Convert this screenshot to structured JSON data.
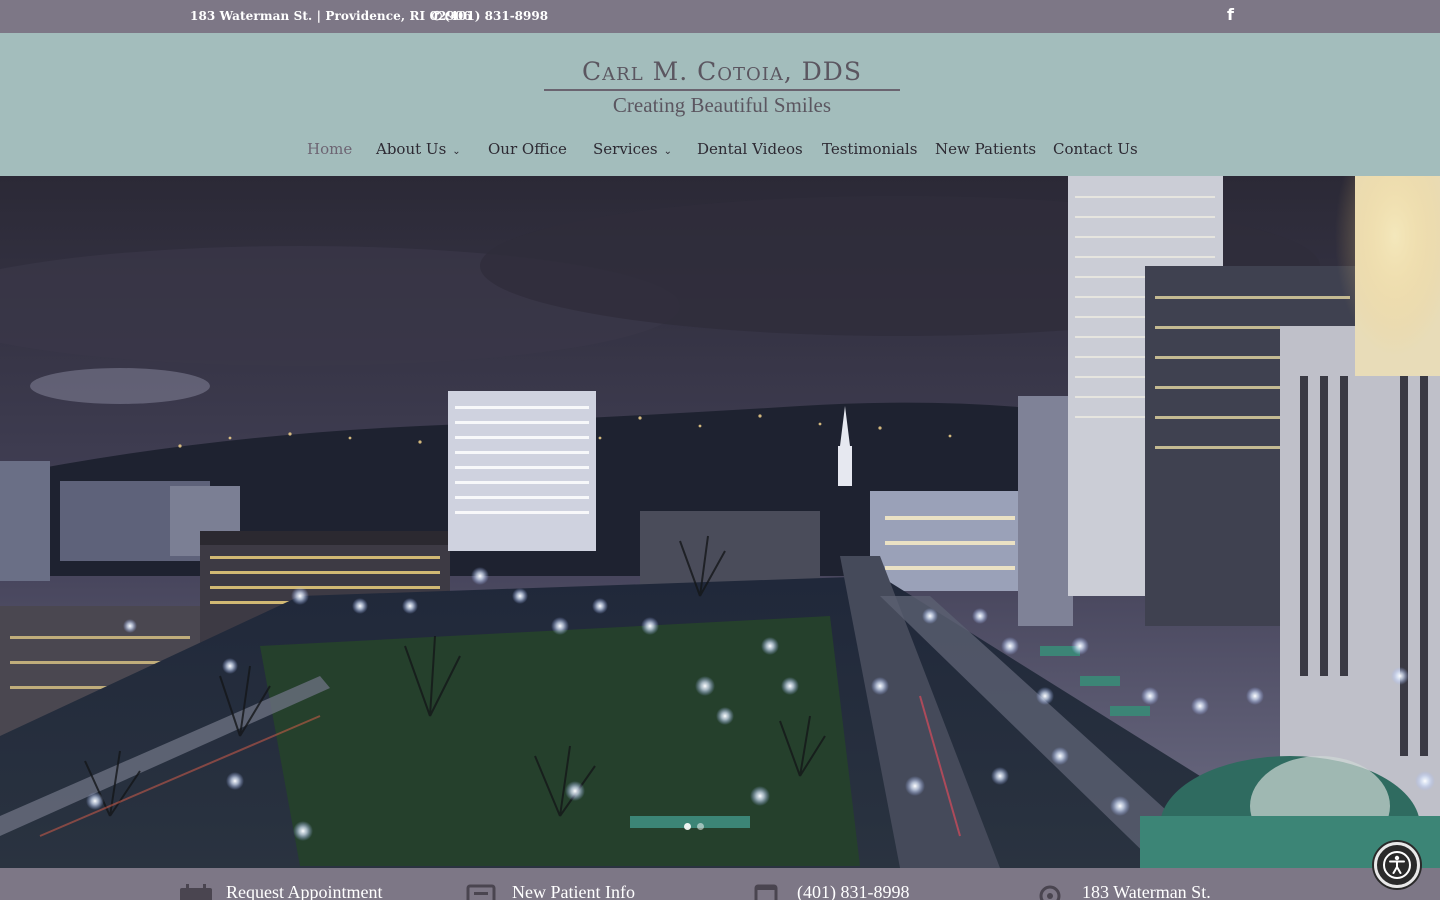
{
  "topbar": {
    "address": "183 Waterman St. | Providence, RI 02906",
    "phone": "(401) 831-8998",
    "facebook_glyph": "f"
  },
  "logo": {
    "name": "Carl M. Cotoia, DDS",
    "tagline": "Creating Beautiful Smiles"
  },
  "nav": {
    "items": [
      {
        "label": "Home",
        "active": true
      },
      {
        "label": "About Us",
        "dropdown": true
      },
      {
        "label": "Our Office"
      },
      {
        "label": "Services",
        "dropdown": true
      },
      {
        "label": "Dental Videos"
      },
      {
        "label": "Testimonials"
      },
      {
        "label": "New Patients"
      },
      {
        "label": "Contact Us"
      }
    ]
  },
  "bottombar": {
    "items": [
      {
        "icon": "calendar-icon",
        "label": "Request Appointment"
      },
      {
        "icon": "message-icon",
        "label": "New Patient Info"
      },
      {
        "icon": "calendar-icon",
        "label": "(401) 831-8998"
      },
      {
        "icon": "map-pin-icon",
        "label": "183 Waterman St."
      }
    ]
  },
  "colors": {
    "topbar": "#7d7786",
    "header": "#a3bdbc",
    "nav_text": "#2d2a33",
    "nav_active": "#6d6573"
  }
}
